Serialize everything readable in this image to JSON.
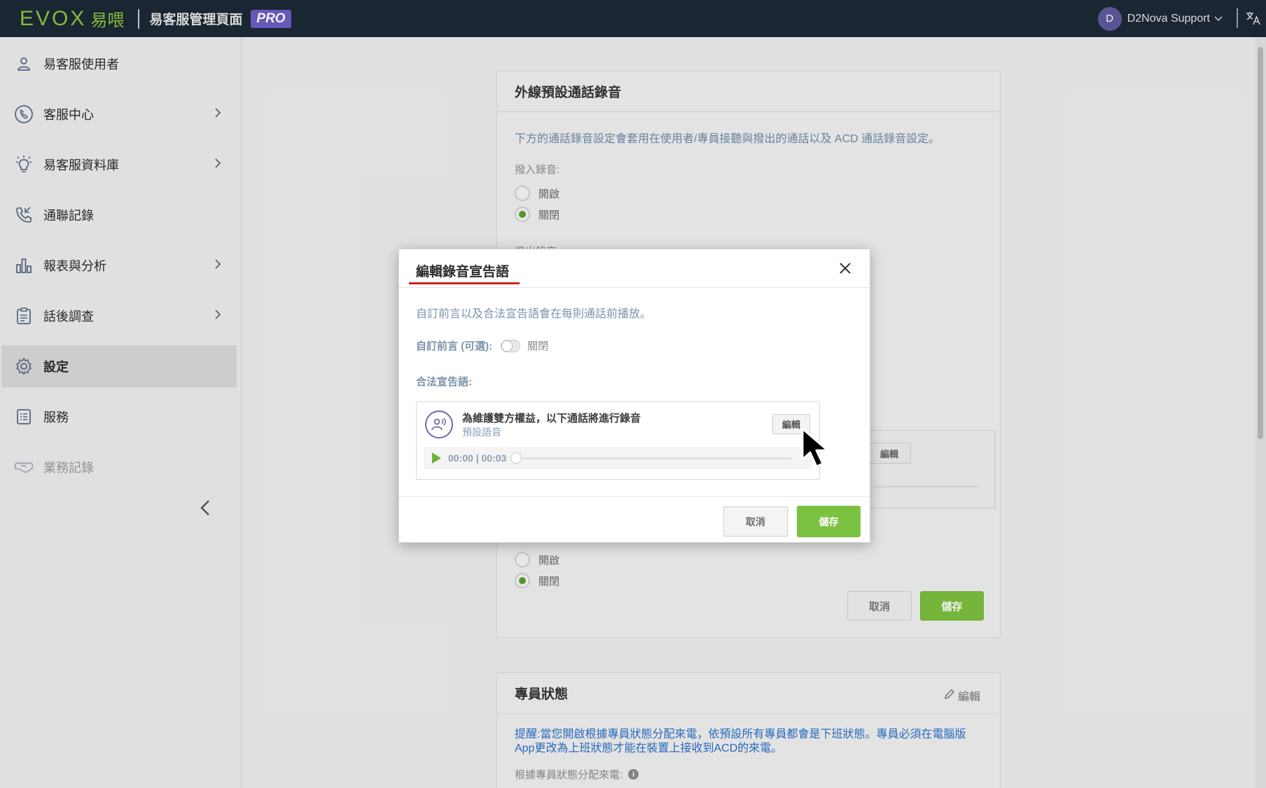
{
  "app": {
    "logo_text": "EVOX",
    "logo_cn": "易喂",
    "title": "易客服管理頁面",
    "badge": "PRO",
    "user_initial": "D",
    "user_name": "D2Nova Support"
  },
  "sidebar": {
    "items": [
      {
        "label": "易客服使用者",
        "icon": "user-icon",
        "has_children": false
      },
      {
        "label": "客服中心",
        "icon": "call-center-icon",
        "has_children": true
      },
      {
        "label": "易客服資料庫",
        "icon": "lightbulb-icon",
        "has_children": true
      },
      {
        "label": "通聯記錄",
        "icon": "phone-log-icon",
        "has_children": false
      },
      {
        "label": "報表與分析",
        "icon": "bar-chart-icon",
        "has_children": true
      },
      {
        "label": "話後調查",
        "icon": "survey-icon",
        "has_children": true
      },
      {
        "label": "設定",
        "icon": "gear-icon",
        "has_children": false,
        "active": true
      },
      {
        "label": "服務",
        "icon": "service-list-icon",
        "has_children": false
      },
      {
        "label": "業務記錄",
        "icon": "handshake-icon",
        "has_children": false,
        "muted": true
      }
    ]
  },
  "card": {
    "title": "外線預設通話錄音",
    "description": "下方的通話錄音設定會套用在使用者/專員接聽與撥出的通話以及 ACD 通話錄音設定。",
    "inbound_label": "撥入錄音:",
    "option_on": "開啟",
    "option_off": "關閉",
    "outbound_label_partial": "撥出錄音",
    "edit_label": "編輯",
    "cancel_label": "取消",
    "save_label": "儲存"
  },
  "card2": {
    "title": "專員狀態",
    "edit_label": "編輯",
    "note": "提醒:當您開啟根據專員狀態分配來電，依預設所有專員都會是下班狀態。專員必須在電腦版App更改為上班狀態才能在裝置上接收到ACD的來電。",
    "field_label": "根據專員狀態分配來電:"
  },
  "modal": {
    "title": "編輯錄音宣告語",
    "description": "自訂前言以及合法宣告語會在每則通話前播放。",
    "custom_intro_label": "自訂前言 (可選):",
    "custom_intro_state": "關閉",
    "legal_label": "合法宣告語:",
    "audio": {
      "title": "為維護雙方權益，以下通話將進行錄音",
      "subtitle": "預設語音",
      "edit_label": "編輯",
      "time": "00:00 | 00:03"
    },
    "cancel_label": "取消",
    "save_label": "儲存"
  },
  "colors": {
    "topbar": "#1c2a35",
    "brand_green": "#8cc63f",
    "save_green": "#7cc242",
    "pro_purple": "#6c5cc4",
    "accent_red": "#d42020"
  }
}
